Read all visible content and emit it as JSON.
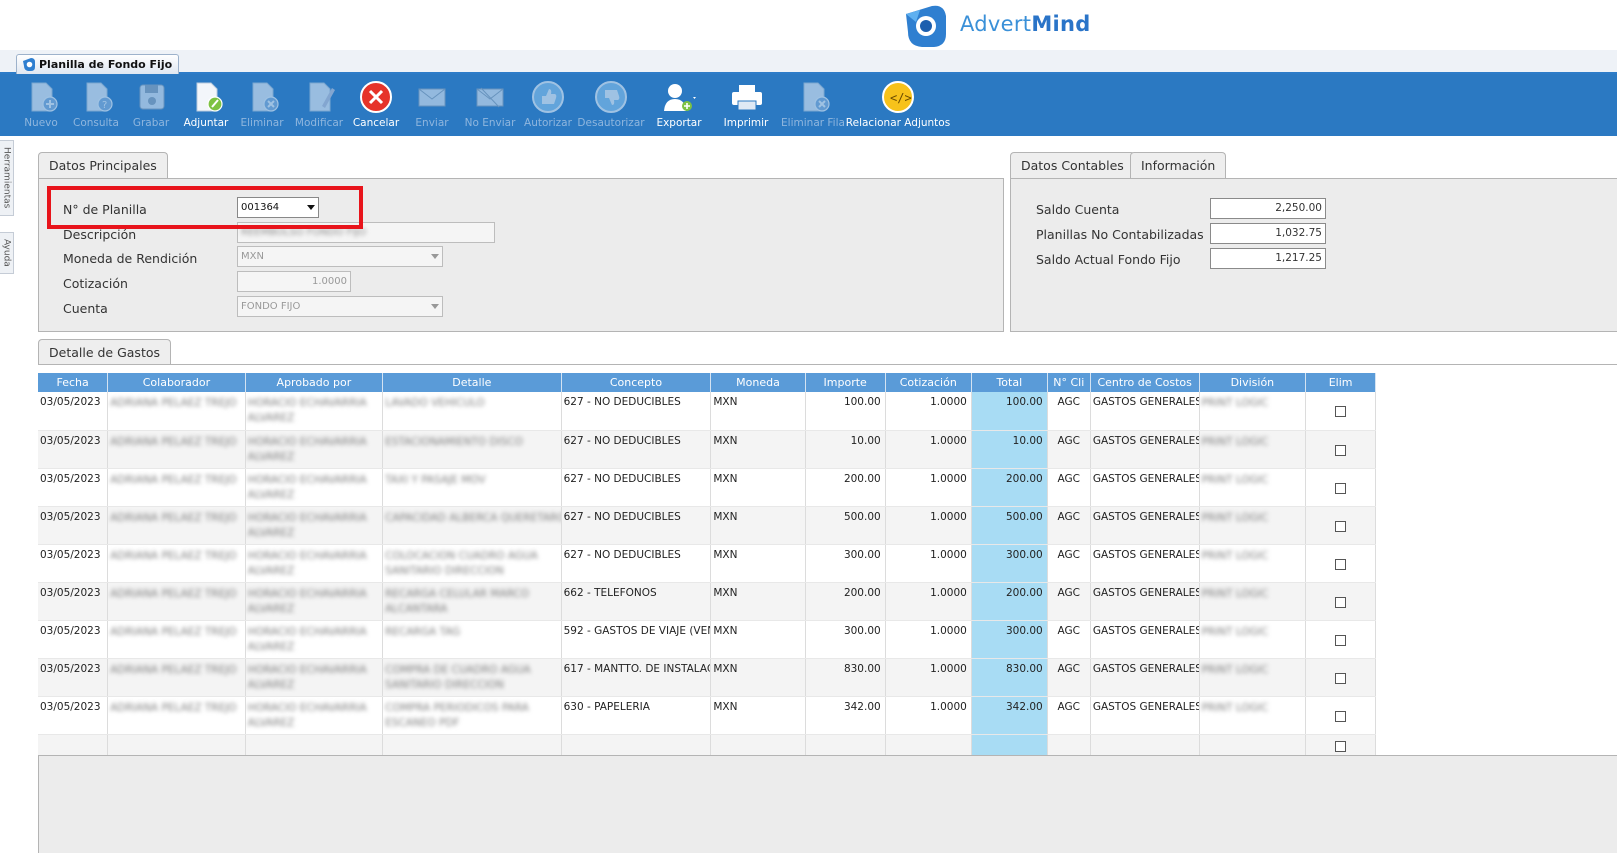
{
  "brand": {
    "name_light": "Advert",
    "name_bold": "Mind"
  },
  "document_tab": {
    "label": "Planilla de Fondo Fijo"
  },
  "toolbar": [
    {
      "label": "Nuevo",
      "icon": "new-doc-icon",
      "enabled": false
    },
    {
      "label": "Consulta",
      "icon": "query-doc-icon",
      "enabled": false
    },
    {
      "label": "Grabar",
      "icon": "save-icon",
      "enabled": false
    },
    {
      "label": "Adjuntar",
      "icon": "attach-doc-icon",
      "enabled": true
    },
    {
      "label": "Eliminar",
      "icon": "delete-doc-icon",
      "enabled": false
    },
    {
      "label": "Modificar",
      "icon": "edit-doc-icon",
      "enabled": false
    },
    {
      "label": "Cancelar",
      "icon": "cancel-icon",
      "enabled": true
    },
    {
      "label": "Enviar",
      "icon": "send-icon",
      "enabled": false
    },
    {
      "label": "No Enviar",
      "icon": "no-send-icon",
      "enabled": false
    },
    {
      "label": "Autorizar",
      "icon": "thumbs-up-icon",
      "enabled": false
    },
    {
      "label": "Desautorizar",
      "icon": "thumbs-down-icon",
      "enabled": false
    },
    {
      "label": "Exportar",
      "icon": "export-user-icon",
      "enabled": true
    },
    {
      "label": "Imprimir",
      "icon": "printer-icon",
      "enabled": true
    },
    {
      "label": "Eliminar Fila",
      "icon": "delete-row-icon",
      "enabled": false
    },
    {
      "label": "Relacionar Adjuntos",
      "icon": "link-attachments-icon",
      "enabled": true
    }
  ],
  "side_tabs": {
    "tools": "Herramientas",
    "help": "Ayuda"
  },
  "datos_principales": {
    "tab_label": "Datos Principales",
    "planilla_label": "N° de Planilla",
    "planilla_value": "001364",
    "descripcion_label": "Descripción",
    "descripcion_value": "REEMBOLSO FONDO FIJO",
    "moneda_label": "Moneda de Rendición",
    "moneda_value": "MXN",
    "cotizacion_label": "Cotización",
    "cotizacion_value": "1.0000",
    "cuenta_label": "Cuenta",
    "cuenta_value": "FONDO FIJO"
  },
  "datos_contables": {
    "tab_label": "Datos Contables",
    "tab2_label": "Información",
    "saldo_cuenta_label": "Saldo Cuenta",
    "saldo_cuenta_value": "2,250.00",
    "no_contabilizadas_label": "Planillas No Contabilizadas",
    "no_contabilizadas_value": "1,032.75",
    "saldo_actual_label": "Saldo Actual Fondo Fijo",
    "saldo_actual_value": "1,217.25"
  },
  "detalle": {
    "tab_label": "Detalle de Gastos",
    "columns": [
      "Fecha",
      "Colaborador",
      "Aprobado por",
      "Detalle",
      "Concepto",
      "Moneda",
      "Importe",
      "Cotización",
      "Total",
      "N° Cli",
      "Centro de Costos",
      "División",
      "Elim"
    ],
    "rows": [
      {
        "fecha": "03/05/2023",
        "colaborador": "ADRIANA PELAEZ TREJO",
        "aprobado": [
          "HORACIO ECHAVARRIA",
          "ALVAREZ"
        ],
        "detalle": [
          "LAVADO VEHICULO",
          ""
        ],
        "concepto": "627 - NO DEDUCIBLES",
        "moneda": "MXN",
        "importe": "100.00",
        "cotizacion": "1.0000",
        "total": "100.00",
        "cli": "AGC",
        "centro": "GASTOS GENERALES",
        "division": "PRINT LOGIC"
      },
      {
        "fecha": "03/05/2023",
        "colaborador": "ADRIANA PELAEZ TREJO",
        "aprobado": [
          "HORACIO ECHAVARRIA",
          "ALVAREZ"
        ],
        "detalle": [
          "ESTACIONAMIENTO DISCO",
          ""
        ],
        "concepto": "627 - NO DEDUCIBLES",
        "moneda": "MXN",
        "importe": "10.00",
        "cotizacion": "1.0000",
        "total": "10.00",
        "cli": "AGC",
        "centro": "GASTOS GENERALES",
        "division": "PRINT LOGIC"
      },
      {
        "fecha": "03/05/2023",
        "colaborador": "ADRIANA PELAEZ TREJO",
        "aprobado": [
          "HORACIO ECHAVARRIA",
          "ALVAREZ"
        ],
        "detalle": [
          "TAXI Y PASAJE MOV",
          ""
        ],
        "concepto": "627 - NO DEDUCIBLES",
        "moneda": "MXN",
        "importe": "200.00",
        "cotizacion": "1.0000",
        "total": "200.00",
        "cli": "AGC",
        "centro": "GASTOS GENERALES",
        "division": "PRINT LOGIC"
      },
      {
        "fecha": "03/05/2023",
        "colaborador": "ADRIANA PELAEZ TREJO",
        "aprobado": [
          "HORACIO ECHAVARRIA",
          "ALVAREZ"
        ],
        "detalle": [
          "CAPACIDAD ALBERCA QUERETARO",
          ""
        ],
        "concepto": "627 - NO DEDUCIBLES",
        "moneda": "MXN",
        "importe": "500.00",
        "cotizacion": "1.0000",
        "total": "500.00",
        "cli": "AGC",
        "centro": "GASTOS GENERALES",
        "division": "PRINT LOGIC"
      },
      {
        "fecha": "03/05/2023",
        "colaborador": "ADRIANA PELAEZ TREJO",
        "aprobado": [
          "HORACIO ECHAVARRIA",
          "ALVAREZ"
        ],
        "detalle": [
          "COLOCACION CUADRO AGUA",
          "SANITARIO DIRECCION"
        ],
        "concepto": "627 - NO DEDUCIBLES",
        "moneda": "MXN",
        "importe": "300.00",
        "cotizacion": "1.0000",
        "total": "300.00",
        "cli": "AGC",
        "centro": "GASTOS GENERALES",
        "division": "PRINT LOGIC"
      },
      {
        "fecha": "03/05/2023",
        "colaborador": "ADRIANA PELAEZ TREJO",
        "aprobado": [
          "HORACIO ECHAVARRIA",
          "ALVAREZ"
        ],
        "detalle": [
          "RECARGA CELULAR MARCO",
          "ALCANTARA"
        ],
        "concepto": "662 - TELEFONOS",
        "moneda": "MXN",
        "importe": "200.00",
        "cotizacion": "1.0000",
        "total": "200.00",
        "cli": "AGC",
        "centro": "GASTOS GENERALES",
        "division": "PRINT LOGIC"
      },
      {
        "fecha": "03/05/2023",
        "colaborador": "ADRIANA PELAEZ TREJO",
        "aprobado": [
          "HORACIO ECHAVARRIA",
          "ALVAREZ"
        ],
        "detalle": [
          "RECARGA TAG",
          ""
        ],
        "concepto": "592 - GASTOS DE VIAJE (VEN",
        "moneda": "MXN",
        "importe": "300.00",
        "cotizacion": "1.0000",
        "total": "300.00",
        "cli": "AGC",
        "centro": "GASTOS GENERALES",
        "division": "PRINT LOGIC"
      },
      {
        "fecha": "03/05/2023",
        "colaborador": "ADRIANA PELAEZ TREJO",
        "aprobado": [
          "HORACIO ECHAVARRIA",
          "ALVAREZ"
        ],
        "detalle": [
          "COMPRA DE CUADRO AGUA",
          "SANITARIO DIRECCION"
        ],
        "concepto": "617 - MANTTO. DE INSTALAC",
        "moneda": "MXN",
        "importe": "830.00",
        "cotizacion": "1.0000",
        "total": "830.00",
        "cli": "AGC",
        "centro": "GASTOS GENERALES",
        "division": "PRINT LOGIC"
      },
      {
        "fecha": "03/05/2023",
        "colaborador": "ADRIANA PELAEZ TREJO",
        "aprobado": [
          "HORACIO ECHAVARRIA",
          "ALVAREZ"
        ],
        "detalle": [
          "COMPRA PERIODICOS PARA",
          "ESCANEO PDF"
        ],
        "concepto": "630 - PAPELERIA",
        "moneda": "MXN",
        "importe": "342.00",
        "cotizacion": "1.0000",
        "total": "342.00",
        "cli": "AGC",
        "centro": "GASTOS GENERALES",
        "division": "PRINT LOGIC"
      }
    ]
  },
  "colors": {
    "toolbar_bg": "#2b79c2",
    "grid_header": "#5a9bd8",
    "total_col": "#a8dcf4",
    "highlight": "#e8141b"
  }
}
